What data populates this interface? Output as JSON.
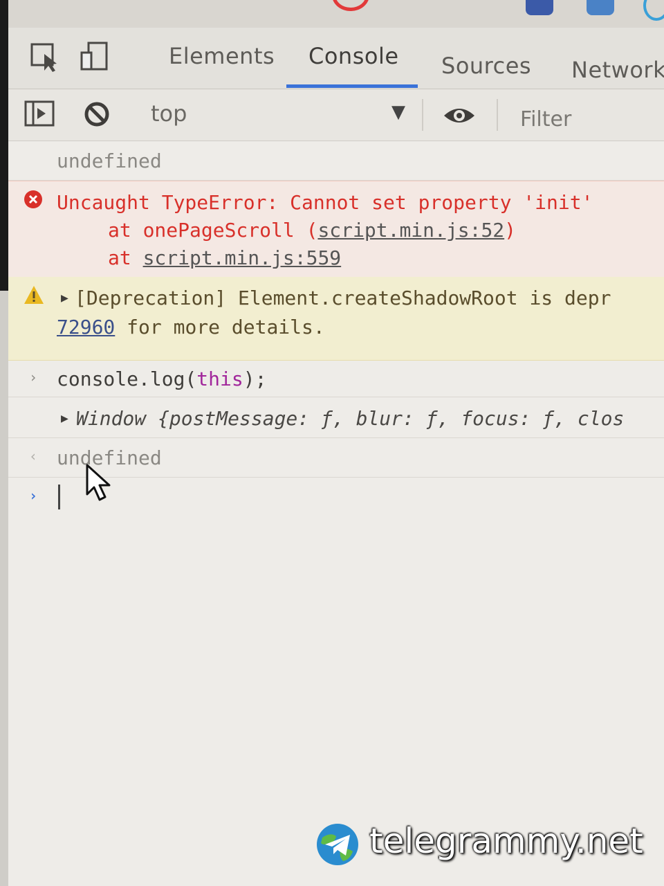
{
  "tabs": {
    "elements": "Elements",
    "console": "Console",
    "sources": "Sources",
    "network": "Network"
  },
  "toolbar": {
    "context": "top",
    "filter_placeholder": "Filter"
  },
  "console": {
    "undefined_1": "undefined",
    "error": {
      "message": "Uncaught TypeError: Cannot set property 'init'",
      "stack1_prefix": "at onePageScroll (",
      "stack1_link": "script.min.js:52",
      "stack1_suffix": ")",
      "stack2_prefix": "at ",
      "stack2_link": "script.min.js:559"
    },
    "warning": {
      "line1": "[Deprecation] Element.createShadowRoot is depr",
      "link": "72960",
      "line2_rest": " for more details."
    },
    "command": {
      "pre": "console.log(",
      "kw": "this",
      "post": ");"
    },
    "window_obj": "Window {postMessage: ƒ, blur: ƒ, focus: ƒ, clos",
    "undefined_2": "undefined"
  },
  "watermark": "telegrammy.net",
  "colors": {
    "accent": "#3a72d8",
    "error": "#d8302a",
    "warning_bg": "#f2eed0",
    "error_bg": "#f4e8e3"
  }
}
